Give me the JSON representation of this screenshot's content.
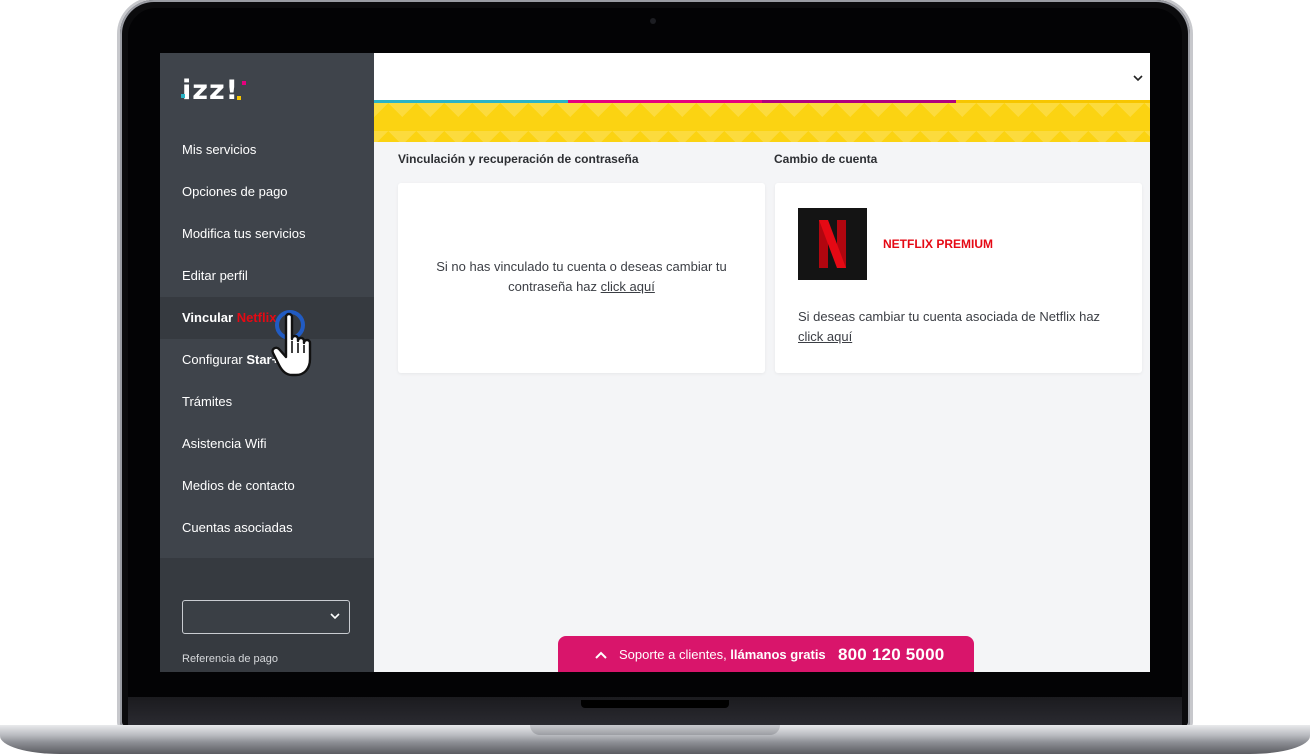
{
  "brand": {
    "logo_text": "izz!"
  },
  "sidebar": {
    "items": [
      {
        "label": "Mis servicios"
      },
      {
        "label": "Opciones de pago"
      },
      {
        "label": "Modifica tus servicios"
      },
      {
        "label": "Editar perfil"
      },
      {
        "label": "Vincular ",
        "accent": "Netflix",
        "active": true
      },
      {
        "label": "Configurar ",
        "strong": "Star+"
      },
      {
        "label": "Trámites"
      },
      {
        "label": "Asistencia Wifi"
      },
      {
        "label": "Medios de contacto"
      },
      {
        "label": "Cuentas asociadas"
      }
    ],
    "select_value": "",
    "reference_label": "Referencia de pago"
  },
  "main": {
    "stripe_colors": [
      "#2ab3c6",
      "#e6007e",
      "#b1007e",
      "#f7c600"
    ],
    "left_section": {
      "title": "Vinculación y recuperación de contraseña",
      "text": "Si no has vinculado tu cuenta o deseas cambiar tu contraseña haz ",
      "link": "click aquí"
    },
    "right_section": {
      "title": "Cambio de cuenta",
      "product": "NETFLIX PREMIUM",
      "text": "Si deseas cambiar tu cuenta asociada de Netflix haz ",
      "link": "click aquí"
    }
  },
  "support": {
    "label": "Soporte a clientes, ",
    "label_bold": "llámanos gratis",
    "phone": "800 120 5000"
  },
  "colors": {
    "sidebar_bg": "#3f444b",
    "netflix_red": "#e50914",
    "support_pink": "#d9156b",
    "banner_yellow": "#fbd312"
  }
}
